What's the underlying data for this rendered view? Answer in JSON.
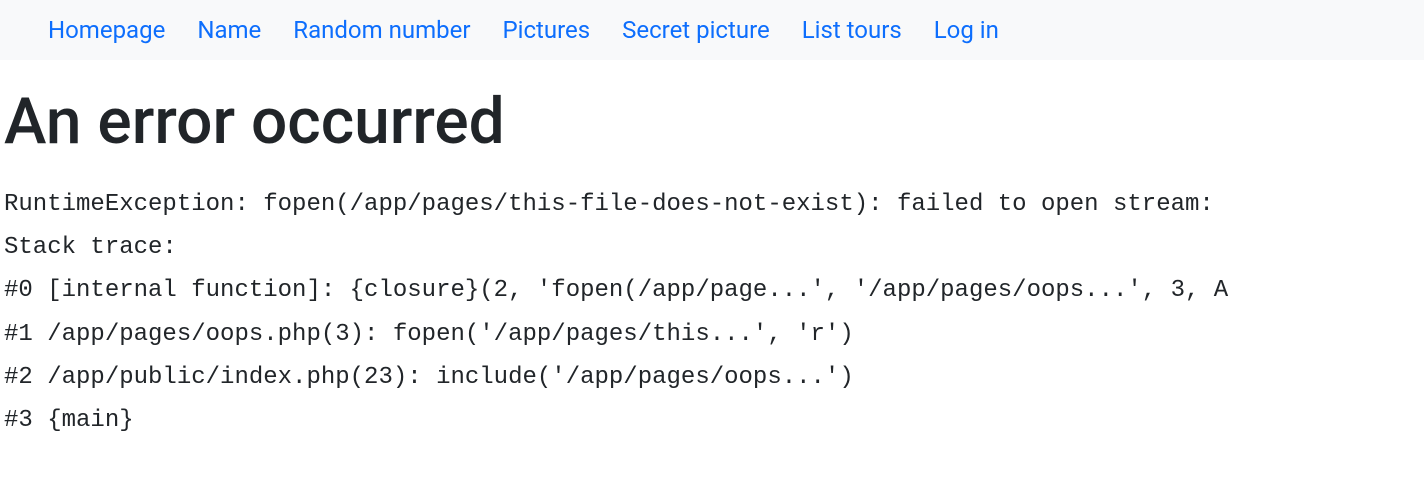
{
  "nav": {
    "items": [
      {
        "label": "Homepage"
      },
      {
        "label": "Name"
      },
      {
        "label": "Random number"
      },
      {
        "label": "Pictures"
      },
      {
        "label": "Secret picture"
      },
      {
        "label": "List tours"
      },
      {
        "label": "Log in"
      }
    ]
  },
  "page": {
    "heading": "An error occurred"
  },
  "error": {
    "trace": "RuntimeException: fopen(/app/pages/this-file-does-not-exist): failed to open stream: \nStack trace:\n#0 [internal function]: {closure}(2, 'fopen(/app/page...', '/app/pages/oops...', 3, A\n#1 /app/pages/oops.php(3): fopen('/app/pages/this...', 'r')\n#2 /app/public/index.php(23): include('/app/pages/oops...')\n#3 {main}"
  }
}
